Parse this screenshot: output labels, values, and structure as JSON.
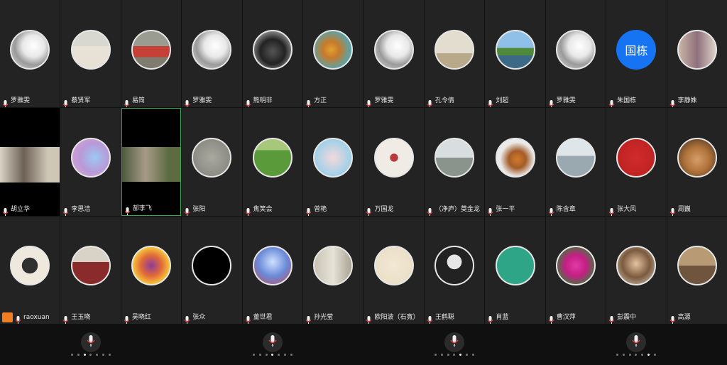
{
  "rows": [
    [
      {
        "name": "罗雅雯",
        "avatar": "sketch-portrait"
      },
      {
        "name": "蔡贤军",
        "avatar": "person-photo"
      },
      {
        "name": "易简",
        "avatar": "red-painting"
      },
      {
        "name": "罗雅雯",
        "avatar": "sketch-portrait"
      },
      {
        "name": "熊明非",
        "avatar": "bull-photo"
      },
      {
        "name": "方正",
        "avatar": "map-illustration"
      },
      {
        "name": "罗雅雯",
        "avatar": "sketch-portrait"
      },
      {
        "name": "孔令倩",
        "avatar": "person-seated"
      },
      {
        "name": "刘超",
        "avatar": "lake-scenery"
      },
      {
        "name": "罗雅雯",
        "avatar": "sketch-portrait"
      },
      {
        "name": "朱国栋",
        "avatar_text": "国栋"
      },
      {
        "name": "李静姝",
        "avatar": "woman-photo"
      }
    ],
    [
      {
        "name": "胡立华",
        "video": true
      },
      {
        "name": "李思洁",
        "avatar": "cartoon-girl"
      },
      {
        "name": "郝李飞",
        "video": true,
        "speaking": true
      },
      {
        "name": "张阳",
        "avatar": "stone-texture"
      },
      {
        "name": "焦笑会",
        "avatar": "grass-field"
      },
      {
        "name": "曾艳",
        "avatar": "bunny-cup"
      },
      {
        "name": "万国龙",
        "avatar": "hydrant"
      },
      {
        "name": "（净庐）莫金龙",
        "avatar": "misty-hills"
      },
      {
        "name": "张一平",
        "avatar": "squirrel"
      },
      {
        "name": "陈含章",
        "avatar": "winter-lake"
      },
      {
        "name": "张大风",
        "avatar": "calligraphy-red"
      },
      {
        "name": "周巍",
        "avatar": "dog-photo"
      }
    ],
    [
      {
        "name": "raoxuan",
        "avatar": "seal-stamp",
        "host": true
      },
      {
        "name": "王玉晓",
        "avatar": "person-red"
      },
      {
        "name": "吴晓红",
        "avatar": "colorful-pattern"
      },
      {
        "name": "张众",
        "avatar": "black-calligraphy"
      },
      {
        "name": "董世君",
        "avatar": "anime-girl"
      },
      {
        "name": "孙光莹",
        "avatar": "building"
      },
      {
        "name": "欧阳波（石寬）",
        "avatar": "calligraphy-seal"
      },
      {
        "name": "王鹤聪",
        "avatar": "man-suit"
      },
      {
        "name": "肖蓝",
        "avatar": "teal-solid"
      },
      {
        "name": "曹汉萍",
        "avatar": "pink-flowers"
      },
      {
        "name": "彭震中",
        "avatar": "portrait-painting"
      },
      {
        "name": "高源",
        "avatar": "man-dog"
      }
    ]
  ],
  "pages": [
    {
      "active": 2
    },
    {
      "active": 3
    },
    {
      "active": 4
    },
    {
      "active": 5
    }
  ],
  "colors": {
    "speaking": "#2fae4e",
    "host": "#f07e20",
    "avatar_text_bg": "#1673f2"
  }
}
